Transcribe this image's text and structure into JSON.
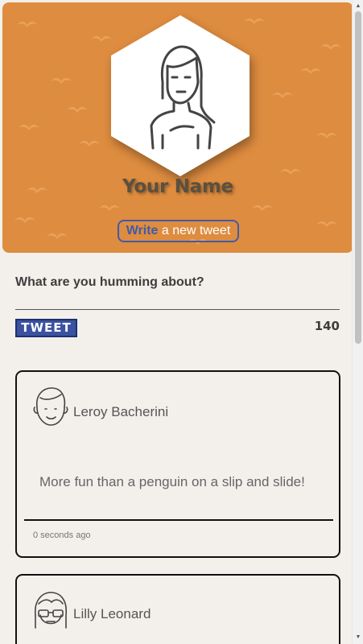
{
  "header": {
    "profile_name": "Your Name",
    "write_button": {
      "bold": "Write",
      "rest": " a new tweet"
    },
    "banner_color": "#de8c3f",
    "accent_color": "#3f5ba8"
  },
  "composer": {
    "prompt": "What are you humming about?",
    "tweet_button": "TWEET",
    "char_count": "140"
  },
  "tweets": [
    {
      "author": "Leroy Bacherini",
      "text": "More fun than a penguin on a slip and slide!",
      "timestamp": "0 seconds ago",
      "avatar_icon": "boy-avatar-icon"
    },
    {
      "author": "Lilly Leonard",
      "avatar_icon": "girl-glasses-avatar-icon"
    }
  ],
  "icons": {
    "profile": "girl-avatar-icon",
    "pattern": "seagull-icon",
    "scroll_up": "▲",
    "scroll_down": "▼"
  }
}
